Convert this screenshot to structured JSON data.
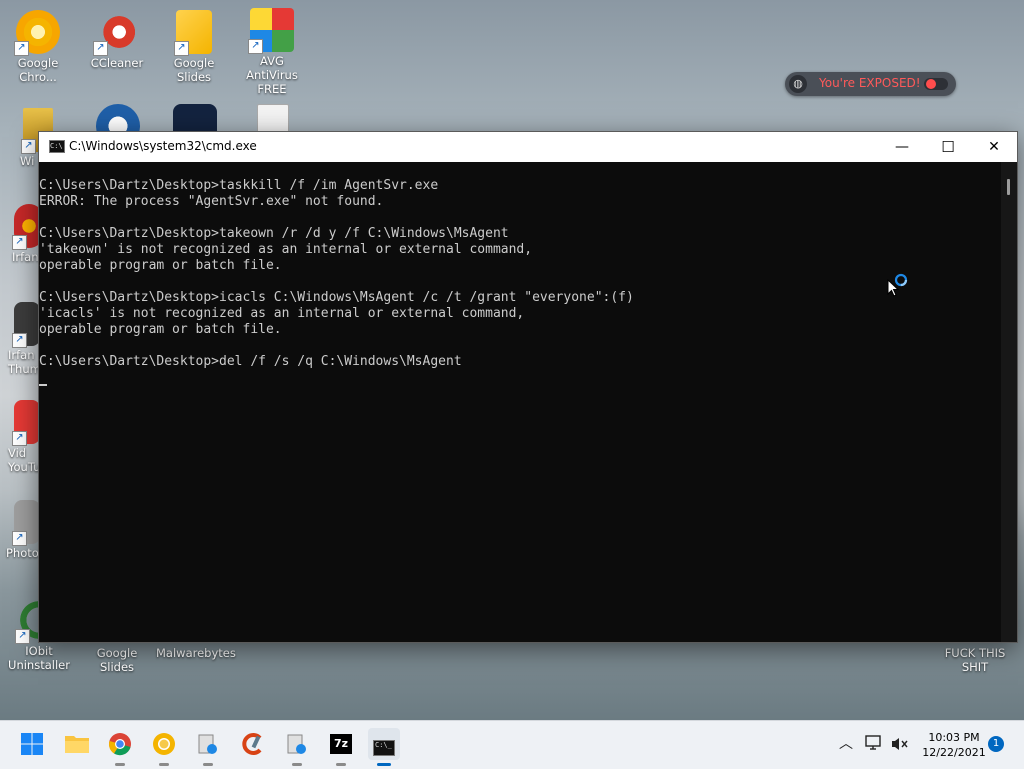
{
  "desktop": {
    "icons": [
      {
        "label": "Google Chro...",
        "icon": "chrome-canary-icon"
      },
      {
        "label": "CCleaner",
        "icon": "ccleaner-icon"
      },
      {
        "label": "Google Slides",
        "icon": "google-slides-icon"
      },
      {
        "label": "AVG AntiVirus FREE",
        "icon": "avg-antivirus-icon"
      },
      {
        "label": "Wi",
        "icon": "winrar-icon"
      },
      {
        "label": "Irfan",
        "icon": "irfanview-icon"
      },
      {
        "label": "Irfan Thum",
        "icon": "irfanview-thumbnails-icon"
      },
      {
        "label": "Vid YouTu",
        "icon": "video-youtube-icon"
      },
      {
        "label": "Photo",
        "icon": "photo-app-icon"
      },
      {
        "label": "IObit Uninstaller",
        "icon": "iobit-uninstaller-icon"
      },
      {
        "label": "Google Slides",
        "icon": "google-slides-icon"
      },
      {
        "label": "Malwarebytes",
        "icon": "malwarebytes-icon"
      },
      {
        "label": "FUCK THIS SHIT",
        "icon": "folder-icon"
      }
    ]
  },
  "notification_pill": {
    "text": "You're EXPOSED!",
    "accent": "#ff5a5a"
  },
  "cmd_window": {
    "title": "C:\\Windows\\system32\\cmd.exe",
    "controls": {
      "minimize": "—",
      "maximize": "☐",
      "close": "✕"
    },
    "lines": [
      "",
      "C:\\Users\\Dartz\\Desktop>taskkill /f /im AgentSvr.exe",
      "ERROR: The process \"AgentSvr.exe\" not found.",
      "",
      "C:\\Users\\Dartz\\Desktop>takeown /r /d y /f C:\\Windows\\MsAgent",
      "'takeown' is not recognized as an internal or external command,",
      "operable program or batch file.",
      "",
      "C:\\Users\\Dartz\\Desktop>icacls C:\\Windows\\MsAgent /c /t /grant \"everyone\":(f)",
      "'icacls' is not recognized as an internal or external command,",
      "operable program or batch file.",
      "",
      "C:\\Users\\Dartz\\Desktop>del /f /s /q C:\\Windows\\MsAgent",
      ""
    ]
  },
  "taskbar": {
    "apps": [
      {
        "name": "start-button",
        "icon": "windows-logo-icon"
      },
      {
        "name": "file-explorer",
        "icon": "folder-icon"
      },
      {
        "name": "chrome",
        "icon": "chrome-icon"
      },
      {
        "name": "chrome-canary",
        "icon": "chrome-canary-icon"
      },
      {
        "name": "app-5",
        "icon": "installer-icon"
      },
      {
        "name": "ccleaner",
        "icon": "ccleaner-icon"
      },
      {
        "name": "app-7",
        "icon": "installer-icon"
      },
      {
        "name": "7zip",
        "icon": "7zip-icon",
        "label": "7z"
      },
      {
        "name": "cmd",
        "icon": "cmd-icon",
        "label": "C:\\_"
      }
    ],
    "clock": {
      "time": "10:03 PM",
      "date": "12/22/2021"
    },
    "notification_count": "1"
  },
  "colors": {
    "console_bg": "#0c0c0c",
    "console_text": "#cccccc",
    "taskbar_bg": "#eef1f5",
    "active_indicator": "#0067c0"
  }
}
